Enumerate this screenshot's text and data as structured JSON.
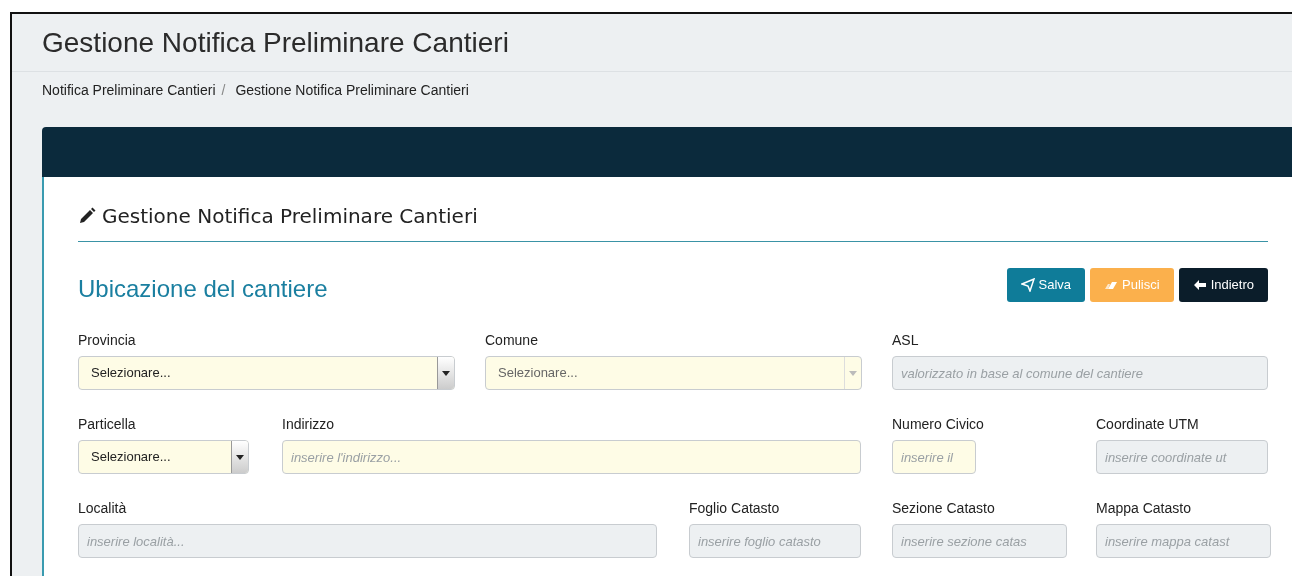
{
  "page_title": "Gestione Notifica Preliminare Cantieri",
  "breadcrumb": {
    "items": [
      "Notifica Preliminare Cantieri",
      "Gestione Notifica Preliminare Cantieri"
    ],
    "separator": "/"
  },
  "card": {
    "title": "Gestione Notifica Preliminare Cantieri",
    "section_title": "Ubicazione del cantiere",
    "buttons": [
      {
        "label": "Salva",
        "kind": "save"
      },
      {
        "label": "Pulisci",
        "kind": "clear"
      },
      {
        "label": "Indietro",
        "kind": "back"
      }
    ],
    "form_rows": [
      [
        {
          "label": "Provincia",
          "kind": "select",
          "value": "Selezionare...",
          "required": true,
          "disabled": false
        },
        {
          "label": "Comune",
          "kind": "select",
          "value": "Selezionare...",
          "required": true,
          "disabled": true
        },
        {
          "label": "ASL",
          "kind": "text",
          "placeholder": "valorizzato in base al comune del cantiere",
          "required": false,
          "disabled": true
        }
      ],
      [
        {
          "label": "Particella",
          "kind": "select",
          "value": "Selezionare...",
          "required": true,
          "disabled": false
        },
        {
          "label": "Indirizzo",
          "kind": "text",
          "placeholder": "inserire l'indirizzo...",
          "required": true,
          "disabled": false
        },
        {
          "label": "Numero Civico",
          "kind": "text",
          "placeholder": "inserire il",
          "required": true,
          "disabled": false
        },
        {
          "label": "Coordinate UTM",
          "kind": "text",
          "placeholder": "inserire coordinate ut",
          "required": false,
          "disabled": true
        }
      ],
      [
        {
          "label": "Località",
          "kind": "text",
          "placeholder": "inserire località...",
          "required": false,
          "disabled": true
        },
        {
          "label": "Foglio Catasto",
          "kind": "text",
          "placeholder": "inserire foglio catasto",
          "required": false,
          "disabled": true
        },
        {
          "label": "Sezione Catasto",
          "kind": "text",
          "placeholder": "inserire sezione catas",
          "required": false,
          "disabled": true
        },
        {
          "label": "Mappa Catasto",
          "kind": "text",
          "placeholder": "inserire mappa catast",
          "required": false,
          "disabled": true
        }
      ]
    ]
  }
}
